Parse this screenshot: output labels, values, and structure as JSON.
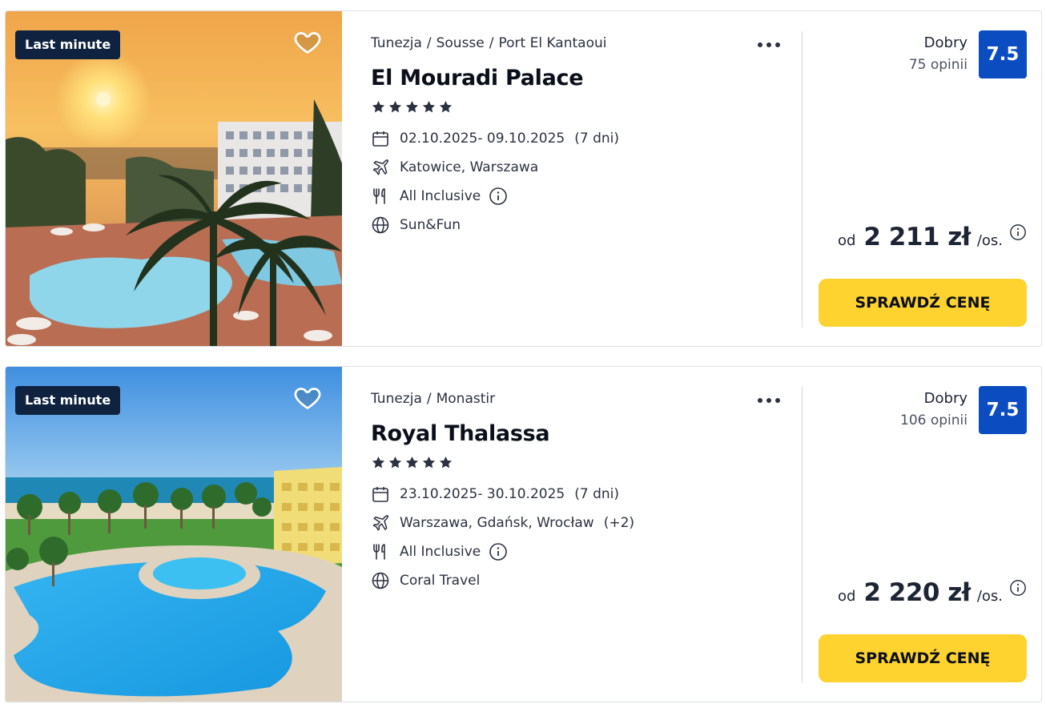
{
  "offers": [
    {
      "badge": "Last minute",
      "breadcrumb": [
        "Tunezja",
        "Sousse",
        "Port El Kantaoui"
      ],
      "name": "El Mouradi Palace",
      "stars": 5,
      "dates": "02.10.2025- 09.10.2025",
      "duration": "(7 dni)",
      "airports": "Katowice, Warszawa",
      "airports_extra": "",
      "board": "All Inclusive",
      "operator": "Sun&Fun",
      "rating_label": "Dobry",
      "rating_count": "75 opinii",
      "rating_score": "7.5",
      "price_from": "od",
      "price": "2 211 zł",
      "price_unit": "/os.",
      "cta": "SPRAWDŹ CENĘ"
    },
    {
      "badge": "Last minute",
      "breadcrumb": [
        "Tunezja",
        "Monastir"
      ],
      "name": "Royal Thalassa",
      "stars": 5,
      "dates": "23.10.2025- 30.10.2025",
      "duration": "(7 dni)",
      "airports": "Warszawa, Gdańsk, Wrocław",
      "airports_extra": "(+2)",
      "board": "All Inclusive",
      "operator": "Coral Travel",
      "rating_label": "Dobry",
      "rating_count": "106 opinii",
      "rating_score": "7.5",
      "price_from": "od",
      "price": "2 220 zł",
      "price_unit": "/os.",
      "cta": "SPRAWDŹ CENĘ"
    }
  ],
  "breadcrumb_separator": "/",
  "colors": {
    "badge_bg": "#0f2340",
    "rating_bg": "#0b4dc1",
    "cta_bg": "#fed22f",
    "star": "#2b3140"
  },
  "icons": {
    "favorite": "heart-icon",
    "more": "more-dots-icon",
    "dates": "calendar-icon",
    "airports": "plane-icon",
    "board": "cutlery-icon",
    "operator": "globe-icon",
    "info": "info-icon",
    "stars": "star-icon"
  }
}
